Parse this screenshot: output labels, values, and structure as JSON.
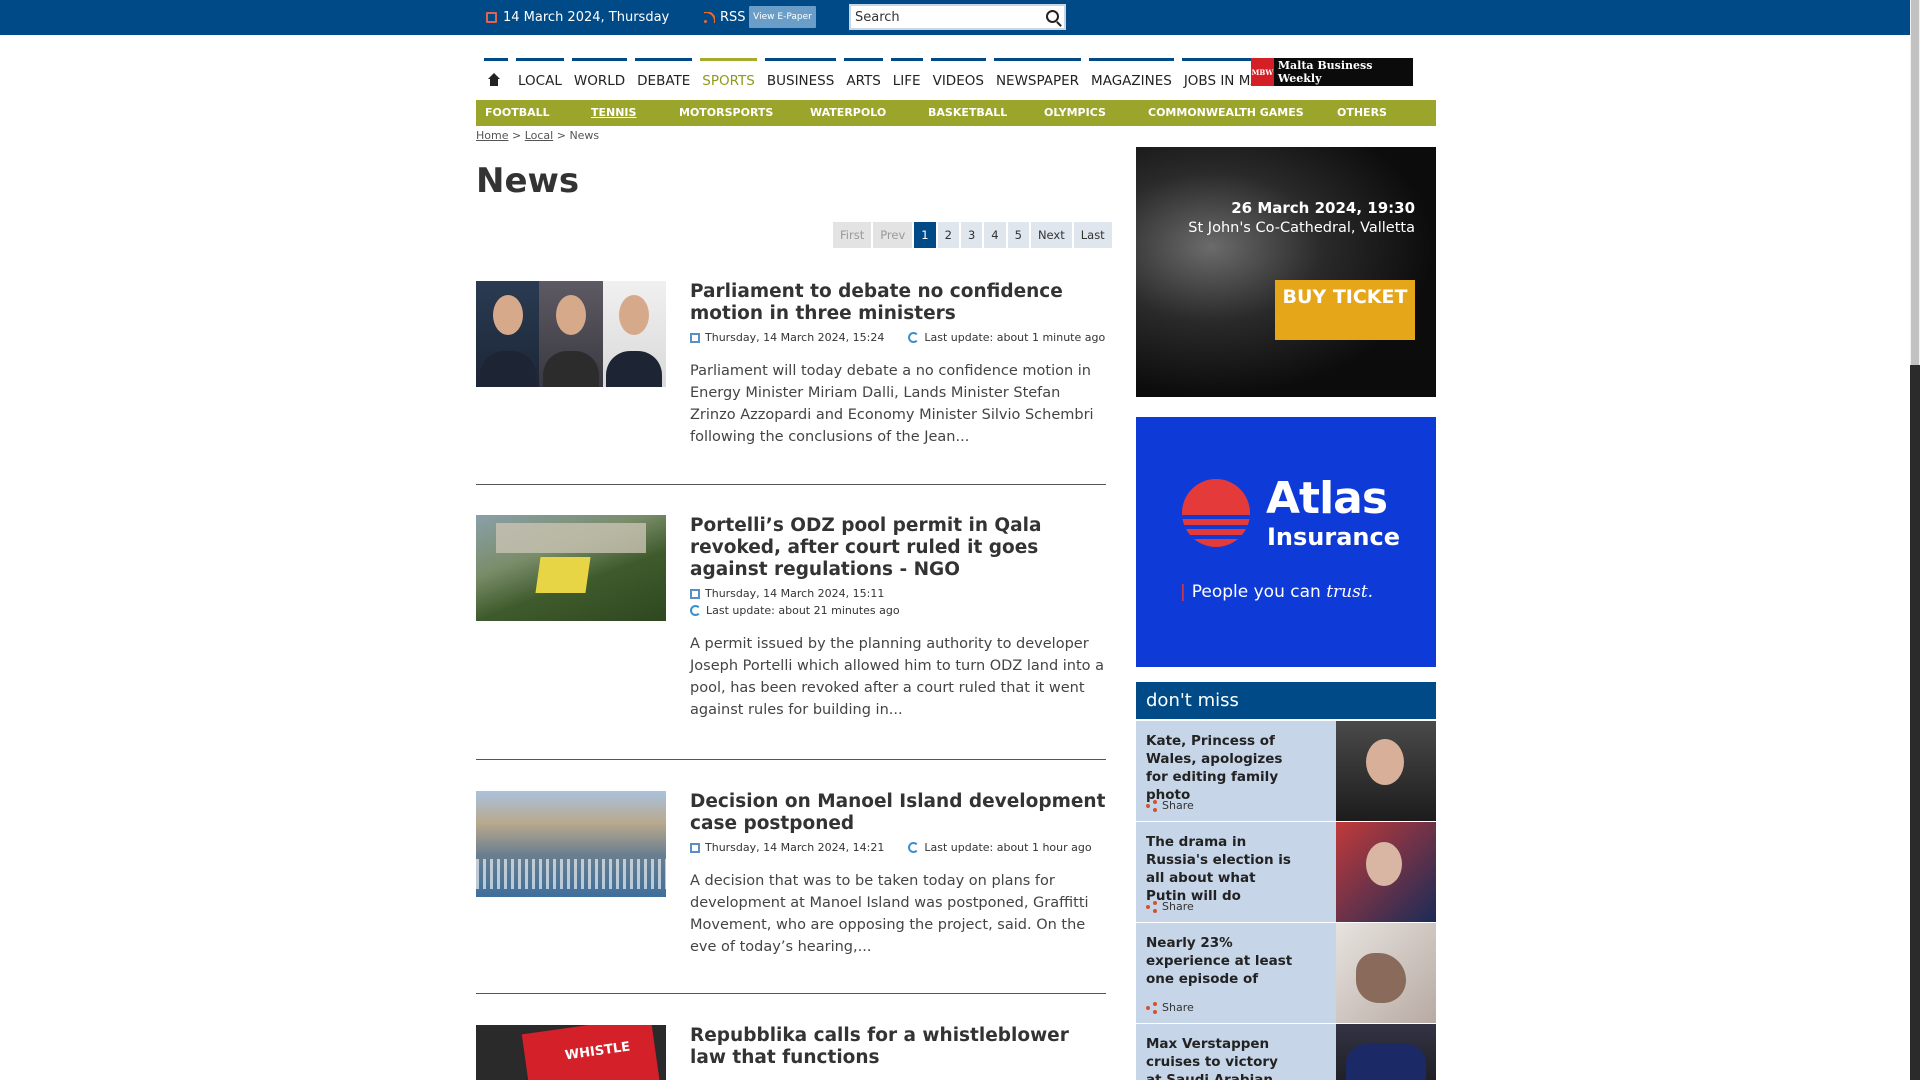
{
  "topbar": {
    "date": "14 March 2024, Thursday",
    "rss": "RSS",
    "epaper": "View E-Paper",
    "search_value": "Search"
  },
  "nav": {
    "items": [
      "LOCAL",
      "WORLD",
      "DEBATE",
      "SPORTS",
      "BUSINESS",
      "ARTS",
      "LIFE",
      "VIDEOS",
      "NEWSPAPER",
      "MAGAZINES",
      "JOBS IN MALTA"
    ],
    "active": "SPORTS",
    "mbw_logo": "MBW",
    "mbw_text": "Malta Business Weekly"
  },
  "subnav": [
    "FOOTBALL",
    "TENNIS",
    "MOTORSPORTS",
    "WATERPOLO",
    "BASKETBALL",
    "OLYMPICS",
    "COMMONWEALTH GAMES",
    "OTHERS"
  ],
  "breadcrumb": {
    "home": "Home",
    "local": "Local",
    "current": "News",
    "sep": ">"
  },
  "page_title": "News",
  "pager": [
    "First",
    "Prev",
    "1",
    "2",
    "3",
    "4",
    "5",
    "Next",
    "Last"
  ],
  "articles": [
    {
      "title": "Parliament to debate no confidence motion in three ministers",
      "date": "Thursday, 14 March 2024, 15:24",
      "update": "Last update: about 1 minute ago",
      "excerpt": "Parliament will today debate a no confidence motion in Energy Minister Miriam Dalli, Lands Minister Stefan Zrinzo Azzopardi and Economy Minister Silvio Schembri following the conclusions of the Jean..."
    },
    {
      "title": "Portelli’s ODZ pool permit in Qala revoked, after court ruled it goes against regulations - NGO",
      "date": "Thursday, 14 March 2024, 15:11",
      "update": "Last update: about 21 minutes ago",
      "excerpt": "A permit issued by the planning authority to developer Joseph Portelli which allowed him to turn ODZ land into a pool, has been revoked after a court ruled that it went against rules for building in..."
    },
    {
      "title": "Decision on Manoel Island development case postponed",
      "date": "Thursday, 14 March 2024, 14:21",
      "update": "Last update: about 1 hour ago",
      "excerpt": "A decision that was to be taken today on plans for development at Manoel Island was postponed, Graffitti Movement, who are opposing the project, said. On the eve of today’s hearing,..."
    },
    {
      "title": "Repubblika calls for a whistleblower law that functions",
      "badge": "open",
      "key_text": "WHISTLE"
    }
  ],
  "ads": {
    "concert": {
      "date": "26 March 2024, 19:30",
      "venue": "St John's Co-Cathedral, Valletta",
      "button": "BUY TICKET"
    },
    "atlas": {
      "brand": "Atlas",
      "sub": "Insurance",
      "tag_pre": "People you can ",
      "tag_em": "trust."
    }
  },
  "dont_miss": {
    "heading": "don't miss",
    "share_label": "Share",
    "items": [
      "Kate, Princess of Wales, apologizes for editing family photo",
      "The drama in Russia's election is all about what Putin will do",
      "Nearly 23% experience at least one episode of",
      "Max Verstappen cruises to victory at Saudi Arabian GP to"
    ]
  },
  "colors": {
    "brand_blue": "#004b87",
    "sports_green": "#9ba52b",
    "sidebar_bg": "#c6d5e8",
    "atlas_blue": "#0e3bd8",
    "ticket_gold": "#e5a619"
  }
}
